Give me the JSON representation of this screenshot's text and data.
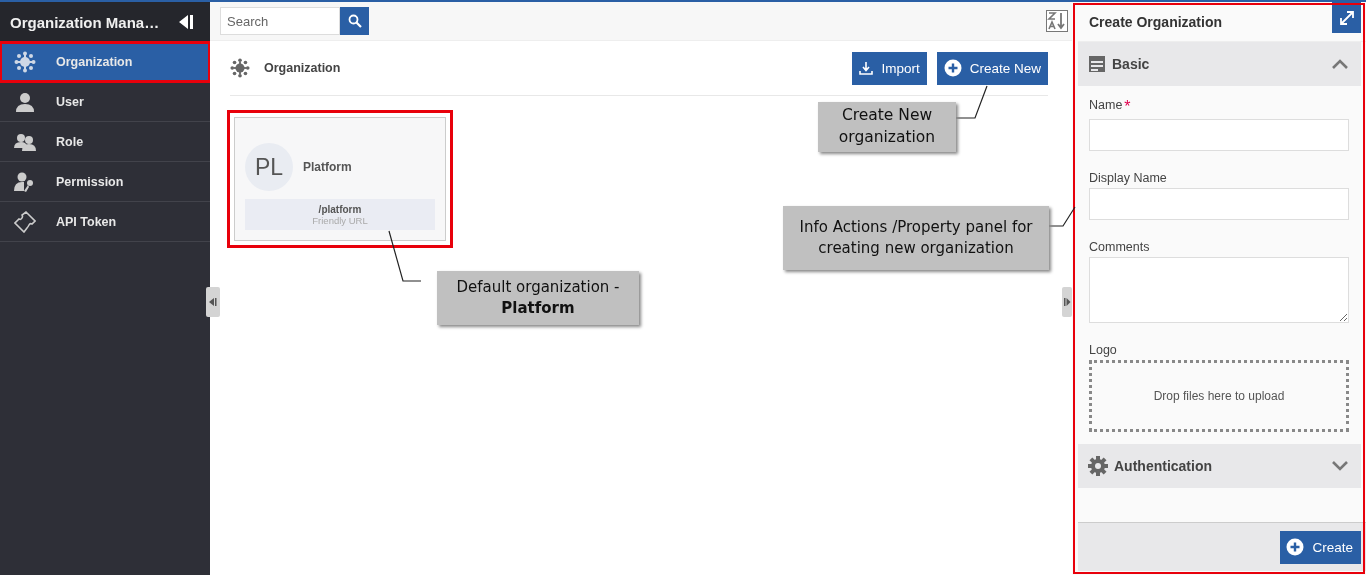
{
  "sidebar": {
    "title": "Organization Mana…",
    "items": [
      {
        "label": "Organization",
        "selected": true,
        "highlighted": true
      },
      {
        "label": "User",
        "selected": false,
        "highlighted": false
      },
      {
        "label": "Role",
        "selected": false,
        "highlighted": false
      },
      {
        "label": "Permission",
        "selected": false,
        "highlighted": false
      },
      {
        "label": "API Token",
        "selected": false,
        "highlighted": false
      }
    ]
  },
  "search": {
    "placeholder": "Search"
  },
  "header": {
    "title": "Organization",
    "buttons": [
      {
        "label": "Import"
      },
      {
        "label": "Create New"
      }
    ]
  },
  "cards": [
    {
      "initials": "PL",
      "name": "Platform",
      "url": "/platform",
      "url_label": "Friendly URL",
      "highlighted": true
    }
  ],
  "panel": {
    "title": "Create Organization",
    "highlighted": true,
    "sections": [
      {
        "title": "Basic",
        "expanded": true,
        "fields": [
          {
            "kind": "text",
            "label": "Name",
            "required_mark": "*"
          },
          {
            "kind": "text",
            "label": "Display Name"
          },
          {
            "kind": "textarea",
            "label": "Comments"
          },
          {
            "kind": "dropzone",
            "label": "Logo",
            "hint": "Drop files here to upload"
          }
        ]
      },
      {
        "title": "Authentication",
        "expanded": false
      }
    ],
    "submit": "Create"
  },
  "callouts": [
    {
      "text": "Create New organization"
    },
    {
      "text": "Info Actions /Property panel for creating new organization"
    },
    {
      "text": "Default organization - **Platform**"
    }
  ]
}
